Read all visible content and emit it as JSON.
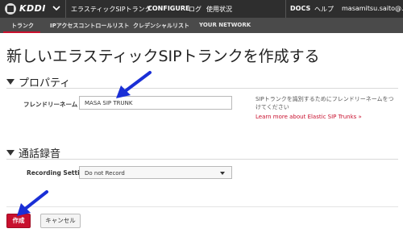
{
  "topnav": {
    "logo_text": "KDDI",
    "items": [
      "エラスティックSIPトランク",
      "CONFIGURE",
      "ログ",
      "使用状況"
    ],
    "right_items": [
      "DOCS",
      "ヘルプ"
    ],
    "user": "masamitsu.saito@..."
  },
  "subnav": {
    "items": [
      "トランク",
      "IPアクセスコントロールリスト",
      "クレデンシャルリスト",
      "YOUR NETWORK"
    ]
  },
  "page": {
    "title": "新しいエラスティックSIPトランクを作成する"
  },
  "properties": {
    "heading": "プロパティ",
    "friendly_name_label": "フレンドリーネーム",
    "friendly_name_value": "MASA SIP TRUNK",
    "help_text": "SIPトランクを識別するためにフレンドリーネームをつけてください",
    "help_link": "Learn more about Elastic SIP Trunks »"
  },
  "recording": {
    "heading": "通話録音",
    "label": "Recording Setting",
    "selected": "Do not Record"
  },
  "actions": {
    "create": "作成",
    "cancel": "キャンセル"
  },
  "colors": {
    "accent": "#c8102e",
    "annotation_arrow": "#1a2fd6",
    "nav_bg": "#2e2e2e",
    "subnav_bg": "#4a4a4a"
  }
}
